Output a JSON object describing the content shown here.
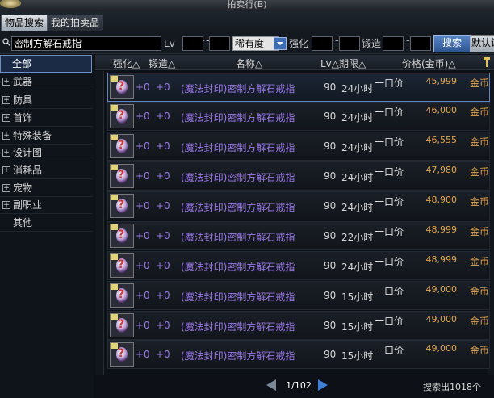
{
  "window": {
    "title": "拍卖行(B)"
  },
  "tabs": [
    {
      "label": "物品搜索"
    },
    {
      "label": "我的拍卖品"
    }
  ],
  "search": {
    "value": "密制方解石戒指",
    "lv_label": "Lv",
    "tilde": "~",
    "rarity": "稀有度",
    "enhance_label": "强化",
    "forge_label": "锻造",
    "button": "搜索",
    "default_button": "默认设置"
  },
  "sidebar": {
    "items": [
      {
        "label": "全部",
        "expandable": false
      },
      {
        "label": "武器",
        "expandable": true
      },
      {
        "label": "防具",
        "expandable": true
      },
      {
        "label": "首饰",
        "expandable": true
      },
      {
        "label": "特殊装备",
        "expandable": true
      },
      {
        "label": "设计图",
        "expandable": true
      },
      {
        "label": "消耗品",
        "expandable": true
      },
      {
        "label": "宠物",
        "expandable": true
      },
      {
        "label": "副职业",
        "expandable": true
      },
      {
        "label": "其他",
        "expandable": false
      }
    ]
  },
  "table": {
    "headers": {
      "enhance": "强化△",
      "forge": "锻造△",
      "name": "名称△",
      "lv_period": "Lv△期限△",
      "price": "价格(金币)△"
    },
    "rows": [
      {
        "enhance": "+0",
        "forge": "+0",
        "name": "(魔法封印)密制方解石戒指",
        "lv": "90",
        "time": "24小时",
        "type": "一口价",
        "price": "45,999",
        "unit": "金币"
      },
      {
        "enhance": "+0",
        "forge": "+0",
        "name": "(魔法封印)密制方解石戒指",
        "lv": "90",
        "time": "24小时",
        "type": "一口价",
        "price": "46,000",
        "unit": "金币"
      },
      {
        "enhance": "+0",
        "forge": "+0",
        "name": "(魔法封印)密制方解石戒指",
        "lv": "90",
        "time": "24小时",
        "type": "一口价",
        "price": "46,555",
        "unit": "金币"
      },
      {
        "enhance": "+0",
        "forge": "+0",
        "name": "(魔法封印)密制方解石戒指",
        "lv": "90",
        "time": "24小时",
        "type": "一口价",
        "price": "47,980",
        "unit": "金币"
      },
      {
        "enhance": "+0",
        "forge": "+0",
        "name": "(魔法封印)密制方解石戒指",
        "lv": "90",
        "time": "24小时",
        "type": "一口价",
        "price": "48,900",
        "unit": "金币"
      },
      {
        "enhance": "+0",
        "forge": "+0",
        "name": "(魔法封印)密制方解石戒指",
        "lv": "90",
        "time": "22小时",
        "type": "一口价",
        "price": "48,999",
        "unit": "金币"
      },
      {
        "enhance": "+0",
        "forge": "+0",
        "name": "(魔法封印)密制方解石戒指",
        "lv": "90",
        "time": "24小时",
        "type": "一口价",
        "price": "48,999",
        "unit": "金币"
      },
      {
        "enhance": "+0",
        "forge": "+0",
        "name": "(魔法封印)密制方解石戒指",
        "lv": "90",
        "time": "15小时",
        "type": "一口价",
        "price": "49,000",
        "unit": "金币"
      },
      {
        "enhance": "+0",
        "forge": "+0",
        "name": "(魔法封印)密制方解石戒指",
        "lv": "90",
        "time": "15小时",
        "type": "一口价",
        "price": "49,000",
        "unit": "金币"
      },
      {
        "enhance": "+0",
        "forge": "+0",
        "name": "(魔法封印)密制方解石戒指",
        "lv": "90",
        "time": "15小时",
        "type": "一口价",
        "price": "49,000",
        "unit": "金币"
      }
    ]
  },
  "pagination": {
    "page": "1/102"
  },
  "footer": {
    "result_count": "搜索出1018个"
  }
}
